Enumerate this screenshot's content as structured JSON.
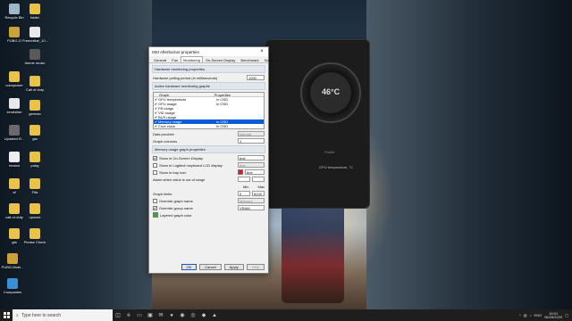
{
  "desktop": {
    "icons": [
      {
        "label": "Recycle Bin"
      },
      {
        "label": "PUBG-G"
      },
      {
        "label": "colorpicker"
      },
      {
        "label": "zendslide"
      },
      {
        "label": "Updated R..."
      },
      {
        "label": "Invoice"
      },
      {
        "label": "af"
      },
      {
        "label": "call-of-duty"
      },
      {
        "label": "gta"
      },
      {
        "label": "PUBG-Mobi..."
      },
      {
        "label": "Companies"
      },
      {
        "label": "folder"
      },
      {
        "label": "Freeonline_10..."
      },
      {
        "label": "theme music"
      },
      {
        "label": "Call of duty"
      },
      {
        "label": "german"
      },
      {
        "label": "gta"
      },
      {
        "label": "pubg"
      },
      {
        "label": "Fifa"
      },
      {
        "label": "upwork"
      },
      {
        "label": "Please Check"
      }
    ]
  },
  "dialog": {
    "title": "MSI Afterburner properties",
    "tabs": [
      "General",
      "Fan",
      "Monitoring",
      "On-Screen Display",
      "Benchmark",
      "Screen c"
    ],
    "active_tab": "Monitoring",
    "sections": {
      "hardware": "Hardware monitoring properties",
      "active_graphs": "Active hardware monitoring graphs",
      "graph_props": "Memory usage graph properties"
    },
    "polling_label": "Hardware polling period (in milliseconds)",
    "polling_value": "1000",
    "list_headers": [
      "Graph",
      "Properties"
    ],
    "graphs": [
      {
        "name": "GPU temperature",
        "props": "in OSD",
        "selected": false
      },
      {
        "name": "GPU usage",
        "props": "in OSD",
        "selected": false
      },
      {
        "name": "FB usage",
        "props": "",
        "selected": false
      },
      {
        "name": "VID usage",
        "props": "",
        "selected": false
      },
      {
        "name": "BUS usage",
        "props": "",
        "selected": false
      },
      {
        "name": "Memory usage",
        "props": "in OSD",
        "selected": true
      },
      {
        "name": "Core clock",
        "props": "in OSD",
        "selected": false
      }
    ],
    "data_provider_label": "Data provider",
    "data_provider_value": "internal",
    "graph_columns_label": "Graph columns",
    "graph_columns_value": "1",
    "osd_label": "Show in On-Screen Display",
    "osd_value": "text",
    "lcd_label": "Show in Logitech keyboard LCD display",
    "lcd_value": "text",
    "tray_label": "Show in tray icon",
    "tray_value": "text",
    "alarm_label": "Alarm when value is out of range",
    "min_label": "Min",
    "max_label": "Max",
    "limits_label": "Graph limits",
    "limit_min": "0",
    "limit_max": "8192",
    "override_name_label": "Override graph name",
    "override_name_value": "Memory usage",
    "override_group_label": "Override group name",
    "override_group_value": "VRAM",
    "layered_label": "Layered graph color",
    "ok": "OK",
    "cancel": "Cancel",
    "apply": "Apply",
    "help": "Help",
    "red_color": "#d62020",
    "green_color": "#2cb52c",
    "selection_color": "#0a5bd6"
  },
  "afterburner": {
    "gauge_temp": "46°C",
    "profile_label": "Profile",
    "graph_label": "GPU temperature, °C"
  },
  "taskbar": {
    "search_placeholder": "Type here to search",
    "language": "ENG",
    "time": "18:01",
    "date": "06/28/2020"
  }
}
